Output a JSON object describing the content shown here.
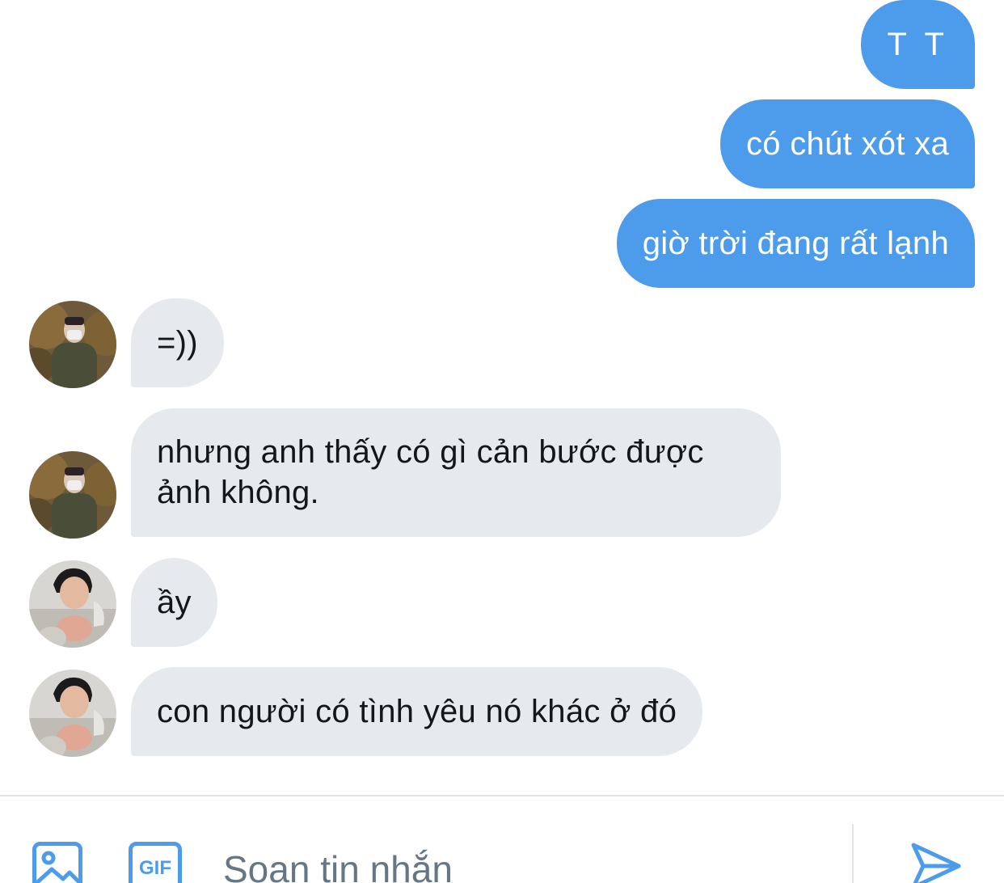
{
  "conversation": {
    "outgoing": [
      {
        "text": "T T"
      },
      {
        "text": "có chút xót xa"
      },
      {
        "text": "giờ trời đang rất lạnh"
      }
    ],
    "incoming": [
      {
        "text": "=))",
        "avatar": "avatar-user-a"
      },
      {
        "text": "nhưng anh thấy có gì cản bước được ảnh không.",
        "avatar": "avatar-user-a"
      },
      {
        "text": "ầy",
        "avatar": "avatar-user-b"
      },
      {
        "text": "con người có tình yêu nó khác ở đó",
        "avatar": "avatar-user-b"
      }
    ]
  },
  "composer": {
    "placeholder": "Soan tin nhắn",
    "gif_label": "GIF",
    "icons": [
      "image-icon",
      "gif-icon",
      "send-icon"
    ]
  },
  "colors": {
    "accent": "#4d9ceb",
    "incoming_bubble": "#e6eaee",
    "text_dark": "#14171a",
    "placeholder": "#657786"
  }
}
